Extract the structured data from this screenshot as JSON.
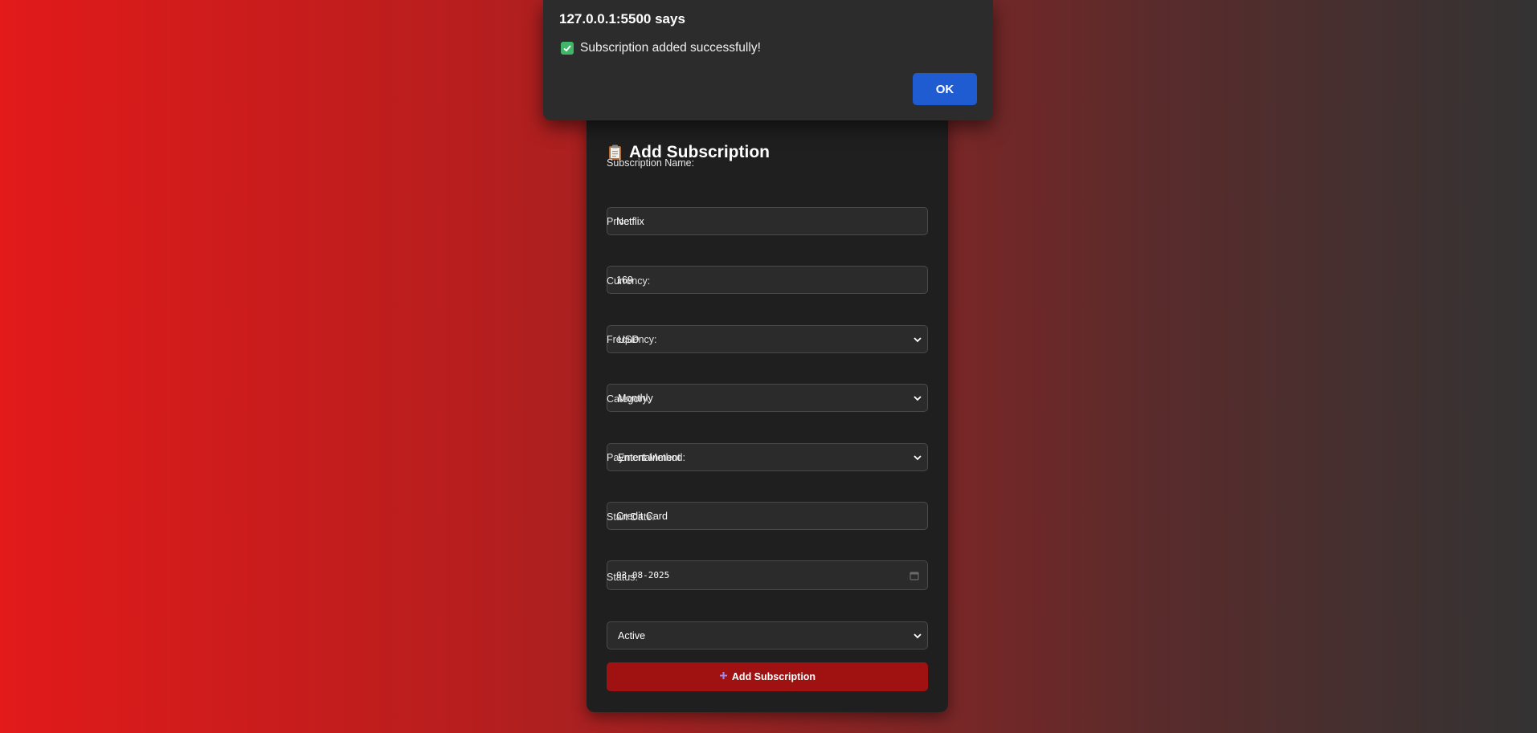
{
  "dialog": {
    "title": "127.0.0.1:5500 says",
    "message": "Subscription added successfully!",
    "ok_label": "OK"
  },
  "form": {
    "title": "Add Subscription",
    "fields": {
      "name": {
        "label": "Subscription Name:",
        "value": "Netflix"
      },
      "price": {
        "label": "Price:",
        "value": "169"
      },
      "currency": {
        "label": "Currency:",
        "value": "USD"
      },
      "frequency": {
        "label": "Frequency:",
        "value": "Monthly"
      },
      "category": {
        "label": "Category:",
        "value": "Entertainment"
      },
      "payment_method": {
        "label": "Payment Method:",
        "value": "Credit Card"
      },
      "start_date": {
        "label": "Start Date:",
        "value": "03-08-2025"
      },
      "status": {
        "label": "Status:",
        "value": "Active"
      }
    },
    "submit_label": "Add Subscription"
  },
  "colors": {
    "background_start": "#e21a1a",
    "background_end": "#333333",
    "card": "#1f1f1f",
    "submit_button": "#a01212",
    "ok_button": "#1f5bd1"
  },
  "icons": [
    "clipboard-icon",
    "check-icon",
    "plus-icon",
    "chevron-down-icon",
    "calendar-icon"
  ]
}
